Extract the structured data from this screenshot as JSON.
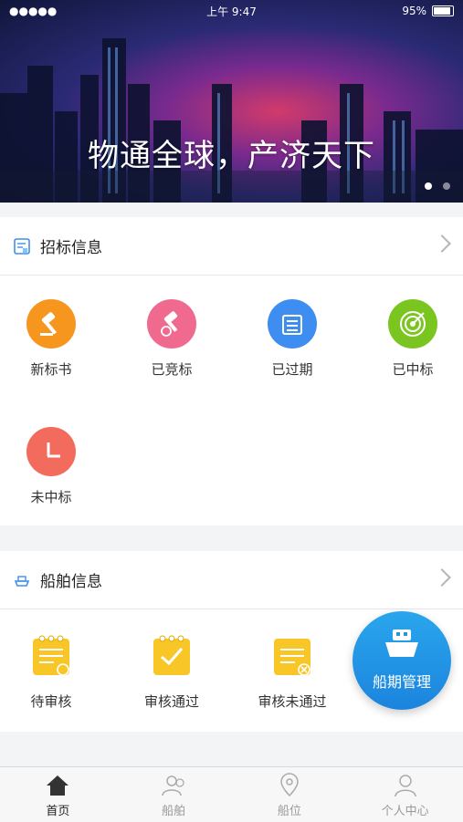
{
  "status_bar": {
    "time": "上午 9:47",
    "battery": "95%"
  },
  "banner": {
    "slogan": "物通全球，产济天下"
  },
  "tender_section": {
    "title": "招标信息",
    "items": [
      {
        "label": "新标书",
        "color": "#f7961e"
      },
      {
        "label": "已竞标",
        "color": "#f06a8f"
      },
      {
        "label": "已过期",
        "color": "#3d8ef0"
      },
      {
        "label": "已中标",
        "color": "#7bc520"
      },
      {
        "label": "未中标",
        "color": "#f36b5c"
      }
    ]
  },
  "ship_section": {
    "title": "船舶信息",
    "items": [
      {
        "label": "待审核",
        "color": "#f9c628"
      },
      {
        "label": "审核通过",
        "color": "#f9c628"
      },
      {
        "label": "审核未通过",
        "color": "#f9c628"
      }
    ]
  },
  "fab": {
    "label": "船期管理"
  },
  "tabbar": {
    "items": [
      {
        "label": "首页",
        "active": true
      },
      {
        "label": "船舶",
        "active": false
      },
      {
        "label": "船位",
        "active": false
      },
      {
        "label": "个人中心",
        "active": false
      }
    ]
  }
}
